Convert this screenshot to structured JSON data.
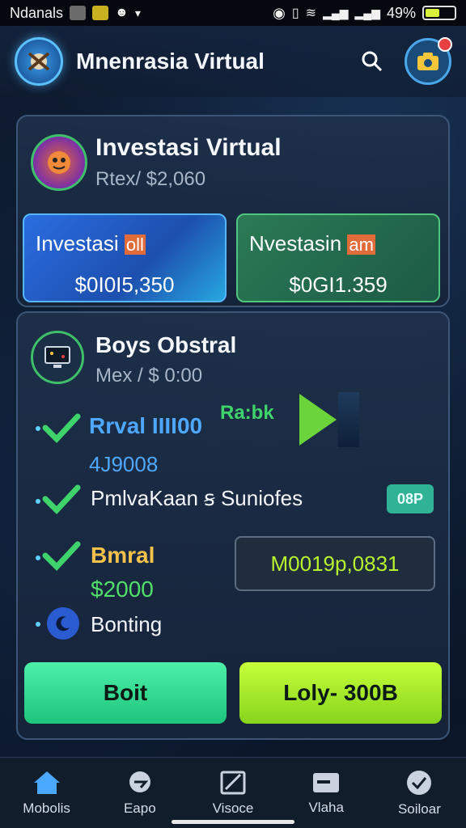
{
  "status_bar": {
    "carrier": "Ndanals",
    "battery": "49%",
    "battery_level": 0.49
  },
  "app_bar": {
    "title": "Mnenrasia Virtual"
  },
  "investment_card": {
    "title": "Investasi Virtual",
    "subtitle": "Rtex/ $2,060",
    "tiles": [
      {
        "label": "Investasi",
        "highlight": "oll",
        "value": "$0I0I5,350"
      },
      {
        "label": "Nvestasin",
        "highlight": "am",
        "value": "$0GI1.359"
      }
    ]
  },
  "detail_card": {
    "title": "Boys Obstral",
    "subtitle": "Mex / $ 0:00",
    "rabk_label": "Ra:bk",
    "rows": [
      {
        "label": "Rrval IIII00",
        "value": "4J9008"
      },
      {
        "label": "PmlvaKaan  ꞩ Suniofes",
        "badge": "08P"
      },
      {
        "label": "Bmral",
        "value": "$2000",
        "field_value": "M0019p,0831"
      },
      {
        "label": "Bonting"
      }
    ],
    "buttons": {
      "primary": "Boit",
      "secondary": "Loly- 300B"
    }
  },
  "bottom_nav": [
    {
      "label": "Mobolis",
      "icon": "home-icon"
    },
    {
      "label": "Eapo",
      "icon": "chat-icon"
    },
    {
      "label": "Visoce",
      "icon": "edit-icon"
    },
    {
      "label": "Vlaha",
      "icon": "card-icon"
    },
    {
      "label": "Soiloar",
      "icon": "check-icon"
    }
  ],
  "colors": {
    "accent_blue": "#4ea8ff",
    "accent_green": "#52e06a",
    "accent_lime": "#b9f22e",
    "accent_gold": "#f4c24a"
  }
}
